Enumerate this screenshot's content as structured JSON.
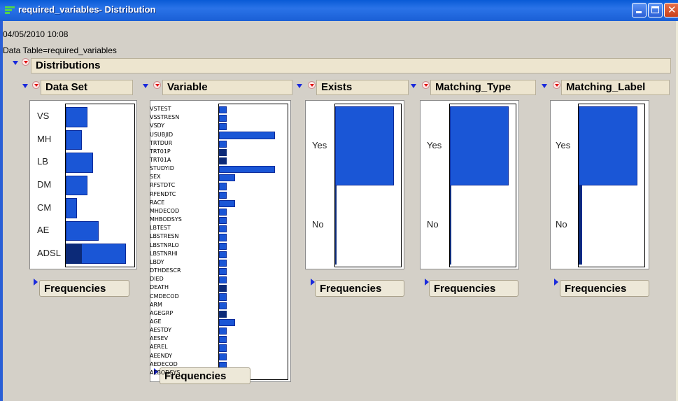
{
  "window": {
    "title": "required_variables- Distribution"
  },
  "report": {
    "timestamp": "04/05/2010 10:08",
    "data_table": "Data Table=required_variables"
  },
  "distributions": {
    "title": "Distributions"
  },
  "panels": {
    "data_set": {
      "title": "Data Set",
      "frequencies_label": "Frequencies",
      "categories": [
        "VS",
        "MH",
        "LB",
        "DM",
        "CM",
        "AE",
        "ADSL"
      ]
    },
    "variable": {
      "title": "Variable",
      "frequencies_label": "Frequencies",
      "categories": [
        "VSTEST",
        "VSSTRESN",
        "VSDY",
        "USUBJID",
        "TRTDUR",
        "TRT01P",
        "TRT01A",
        "STUDYID",
        "SEX",
        "RFSTDTC",
        "RFENDTC",
        "RACE",
        "MHDECOD",
        "MHBODSYS",
        "LBTEST",
        "LBSTRESN",
        "LBSTNRLO",
        "LBSTNRHI",
        "LBDY",
        "DTHDESCR",
        "DIED",
        "DEATH",
        "CMDECOD",
        "ARM",
        "AGEGRP",
        "AGE",
        "AESTDY",
        "AESEV",
        "AEREL",
        "AEENDY",
        "AEDECOD",
        "AEBODSYS"
      ]
    },
    "exists": {
      "title": "Exists",
      "frequencies_label": "Frequencies",
      "categories": [
        "Yes",
        "No"
      ]
    },
    "matching_type": {
      "title": "Matching_Type",
      "frequencies_label": "Frequencies",
      "categories": [
        "Yes",
        "No"
      ]
    },
    "matching_label": {
      "title": "Matching_Label",
      "frequencies_label": "Frequencies",
      "categories": [
        "Yes",
        "No"
      ]
    }
  },
  "chart_data": [
    {
      "type": "bar",
      "title": "Data Set",
      "orientation": "horizontal",
      "categories": [
        "VS",
        "MH",
        "LB",
        "DM",
        "CM",
        "AE",
        "ADSL"
      ],
      "values": [
        4,
        3,
        5,
        4,
        2,
        6,
        11
      ],
      "selected": [
        0,
        0,
        0,
        0,
        0,
        0,
        3
      ]
    },
    {
      "type": "bar",
      "title": "Variable",
      "orientation": "horizontal",
      "categories": [
        "VSTEST",
        "VSSTRESN",
        "VSDY",
        "USUBJID",
        "TRTDUR",
        "TRT01P",
        "TRT01A",
        "STUDYID",
        "SEX",
        "RFSTDTC",
        "RFENDTC",
        "RACE",
        "MHDECOD",
        "MHBODSYS",
        "LBTEST",
        "LBSTRESN",
        "LBSTNRLO",
        "LBSTNRHI",
        "LBDY",
        "DTHDESCR",
        "DIED",
        "DEATH",
        "CMDECOD",
        "ARM",
        "AGEGRP",
        "AGE",
        "AESTDY",
        "AESEV",
        "AEREL",
        "AEENDY",
        "AEDECOD",
        "AEBODSYS"
      ],
      "values": [
        1,
        1,
        1,
        7,
        1,
        1,
        1,
        7,
        2,
        1,
        1,
        2,
        1,
        1,
        1,
        1,
        1,
        1,
        1,
        1,
        1,
        1,
        1,
        1,
        1,
        2,
        1,
        1,
        1,
        1,
        1,
        1
      ],
      "selected": [
        0,
        0,
        0,
        0,
        0,
        1,
        1,
        0,
        0,
        0,
        0,
        0,
        0,
        0,
        0,
        0,
        0,
        0,
        0,
        0,
        0,
        1,
        0,
        0,
        1,
        0,
        0,
        0,
        0,
        0,
        0,
        0
      ]
    },
    {
      "type": "bar",
      "title": "Exists",
      "orientation": "horizontal",
      "categories": [
        "Yes",
        "No"
      ],
      "values": [
        35,
        1
      ],
      "selected": [
        0,
        1
      ]
    },
    {
      "type": "bar",
      "title": "Matching_Type",
      "orientation": "horizontal",
      "categories": [
        "Yes",
        "No"
      ],
      "values": [
        35,
        1
      ],
      "selected": [
        0,
        1
      ]
    },
    {
      "type": "bar",
      "title": "Matching_Label",
      "orientation": "horizontal",
      "categories": [
        "Yes",
        "No"
      ],
      "values": [
        35,
        2
      ],
      "selected": [
        0,
        1
      ]
    }
  ],
  "colors": {
    "bar": "#1a56d6",
    "selected": "#0c2a78",
    "header_bg": "#ede5cf",
    "client_bg": "#d4d0c8",
    "titlebar": "#2a73e8"
  }
}
